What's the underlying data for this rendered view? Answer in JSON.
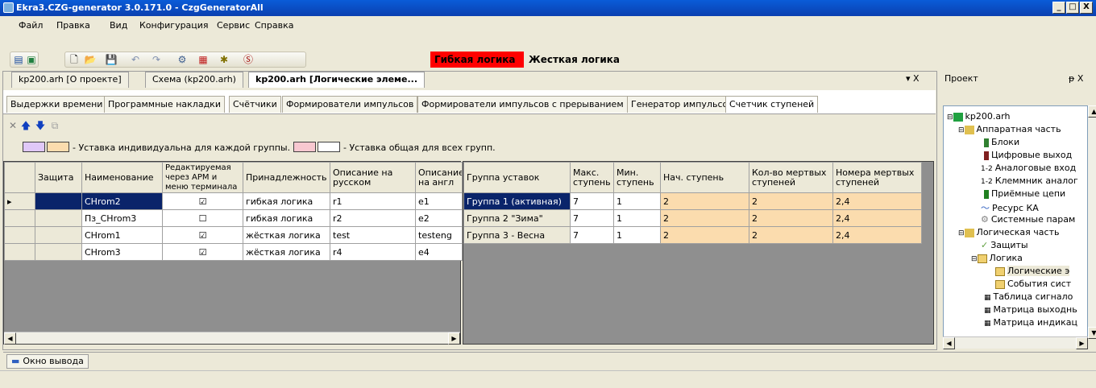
{
  "window": {
    "title": "Ekra3.CZG-generator 3.0.171.0 - CzgGeneratorAll",
    "controls": [
      "_",
      "□",
      "X"
    ]
  },
  "menu": {
    "file": "Файл",
    "edit": "Правка",
    "view": "Вид",
    "config": "Конфигурация",
    "service": "Сервис",
    "help": "Справка"
  },
  "mode_tabs": {
    "flex": "Гибкая логика",
    "hard": "Жесткая логика"
  },
  "doc_tabs": [
    "kp200.arh [О проекте]",
    "Схема (kp200.arh)",
    "kp200.arh [Логические элеме..."
  ],
  "doc_close": "▾ X",
  "sub_tabs": [
    "Выдержки времени",
    "Программные накладки",
    "Счётчики",
    "Формирователи импульсов",
    "Формирователи импульсов с прерыванием",
    "Генератор импульсов",
    "Счетчик ступеней"
  ],
  "legend": {
    "individual": "- Уставка индивидуальна для каждой группы.",
    "common": "- Уставка общая для всех групп."
  },
  "left_table": {
    "headers": [
      "Защита",
      "Наименование",
      "Редактируемая через АРМ и меню терминала",
      "Принадлежность",
      "Описание на русском",
      "Описание на англ"
    ],
    "rows": [
      {
        "name": "CHrom2",
        "editable": "☑",
        "belong": "гибкая логика",
        "ru": "r1",
        "en": "e1"
      },
      {
        "name": "Пз_CHrom3",
        "editable": "☐",
        "belong": "гибкая логика",
        "ru": "r2",
        "en": "e2"
      },
      {
        "name": "CHrom1",
        "editable": "☑",
        "belong": "жёсткая логика",
        "ru": "test",
        "en": "testeng"
      },
      {
        "name": "CHrom3",
        "editable": "☑",
        "belong": "жёсткая логика",
        "ru": "r4",
        "en": "e4"
      }
    ]
  },
  "right_table": {
    "headers": [
      "Группа уставок",
      "Макс. ступень",
      "Мин. ступень",
      "Нач. ступень",
      "Кол-во мертвых ступеней",
      "Номера мертвых ступеней"
    ],
    "rows": [
      {
        "group": "Группа 1 (активная)",
        "max": "7",
        "min": "1",
        "start": "2",
        "dead_count": "2",
        "dead_nums": "2,4"
      },
      {
        "group": "Группа 2 \"Зима\"",
        "max": "7",
        "min": "1",
        "start": "2",
        "dead_count": "2",
        "dead_nums": "2,4"
      },
      {
        "group": "Группа 3 - Весна",
        "max": "7",
        "min": "1",
        "start": "2",
        "dead_count": "2",
        "dead_nums": "2,4"
      }
    ]
  },
  "project": {
    "title": "Проект",
    "pin": "ᵽ X",
    "tree": [
      "kp200.arh",
      "Аппаратная часть",
      "Блоки",
      "Цифровые выход",
      "Аналоговые вход",
      "Клеммник аналог",
      "Приёмные цепи",
      "Ресурс КА",
      "Системные парам",
      "Логическая часть",
      "Защиты",
      "Логика",
      "Логические э",
      "События сист",
      "Таблица сигнало",
      "Матрица выходнь",
      "Матрица индикац"
    ]
  },
  "output_tab": "Окно вывода",
  "colors": {
    "individual_a": "#e0c8f8",
    "individual_b": "#fbdcae",
    "common_a": "#f8c8d0",
    "common_b": "#ffffff",
    "selection": "#0a246a",
    "flex_tab_bg": "#ff0000"
  }
}
